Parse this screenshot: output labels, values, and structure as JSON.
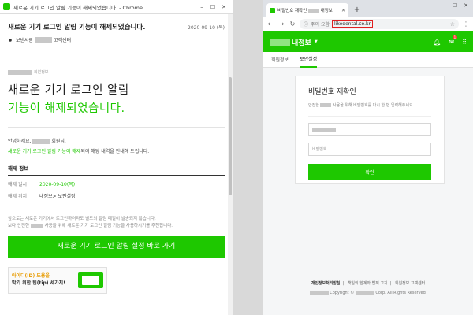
{
  "left": {
    "window_title": "새로운 기기 로그인 알림 기능이 해제되었습니다. - Chrome",
    "subject": "새로운 기기 로그인 알림 기능이 해제되었습니다.",
    "date": "2020-09-10 (목)",
    "sender": "보낸사람",
    "sender_suffix": "고객센터",
    "brand_suffix": "회원정보",
    "hero_line1": "새로운 기기 로그인 알림",
    "hero_line2": "기능이 해제되었습니다.",
    "greeting_prefix": "안녕하세요,",
    "greeting_suffix": "회원님.",
    "intro_green": "새로운 기기 로그인 알림 기능이 해제",
    "intro_rest": "되어 해당 내역을 안내해 드립니다.",
    "section_title": "해제 정보",
    "info": [
      {
        "label": "해제 일시",
        "value": "2020-09-10(목)"
      },
      {
        "label": "해제 위치",
        "value": "내정보> 보안설정"
      }
    ],
    "note_line1": "앞으로는 새로운 기기에서 로그인하더라도 별도의 알림 메일이 발송되지 않습니다.",
    "note_line2_prefix": "보다 안전한",
    "note_line2_suffix": "사용을 위해 새로운 기기 로그인 알림 기능을 사용하시기를 추천합니다.",
    "cta_label": "새로운 기기 로그인 알림 설정 바로 가기",
    "banner_line1": "아이디(ID) 도용을",
    "banner_line2": "막기 위한 팁(tip) 세가지!"
  },
  "right": {
    "tab_title": "비밀번호 재확인",
    "tab_title_suffix": "내정보",
    "addr_prefix": "주의 요함",
    "url": "likedental.co.kr",
    "header_title": "내정보",
    "tabs": [
      "회원정보",
      "보안설정"
    ],
    "card_title": "비밀번호 재확인",
    "card_desc_prefix": "안전한",
    "card_desc_suffix": "사용을 위해 비밀번호를 다시 한 번 입력해주세요.",
    "pw_placeholder": "비밀번호",
    "confirm_label": "확인",
    "footer_links": [
      "개인정보처리방침",
      "책임의 한계와 법적 고지",
      "회원정보 고객센터"
    ],
    "copyright_prefix": "Copyright ©",
    "copyright_suffix": "Corp. All Rights Reserved."
  },
  "icons": {
    "bell": "bell-icon",
    "mail": "mail-icon",
    "apps": "apps-icon"
  },
  "colors": {
    "brand_green": "#1ec800",
    "url_highlight": "#e02020"
  }
}
